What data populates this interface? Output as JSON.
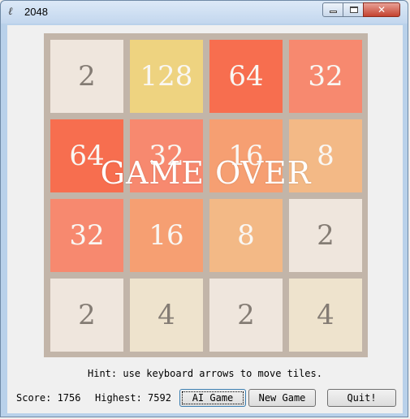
{
  "window": {
    "title": "2048",
    "icon": "feather-icon"
  },
  "board": {
    "rows": [
      [
        2,
        128,
        64,
        32
      ],
      [
        64,
        32,
        16,
        8
      ],
      [
        32,
        16,
        8,
        2
      ],
      [
        2,
        4,
        2,
        4
      ]
    ],
    "colors": {
      "2": "#eee4da",
      "4": "#ede0c8",
      "8": "#f2b179",
      "16": "#f59563",
      "32": "#f67c5f",
      "64": "#f65e3b",
      "128": "#edcf72"
    },
    "overlay_text": "GAME OVER"
  },
  "hint": "Hint: use keyboard arrows to move tiles.",
  "status": {
    "score_label": "Score: 1756",
    "highest_label": "Highest: 7592"
  },
  "buttons": {
    "ai_game": "AI Game",
    "new_game": "New Game",
    "quit": "Quit!"
  }
}
